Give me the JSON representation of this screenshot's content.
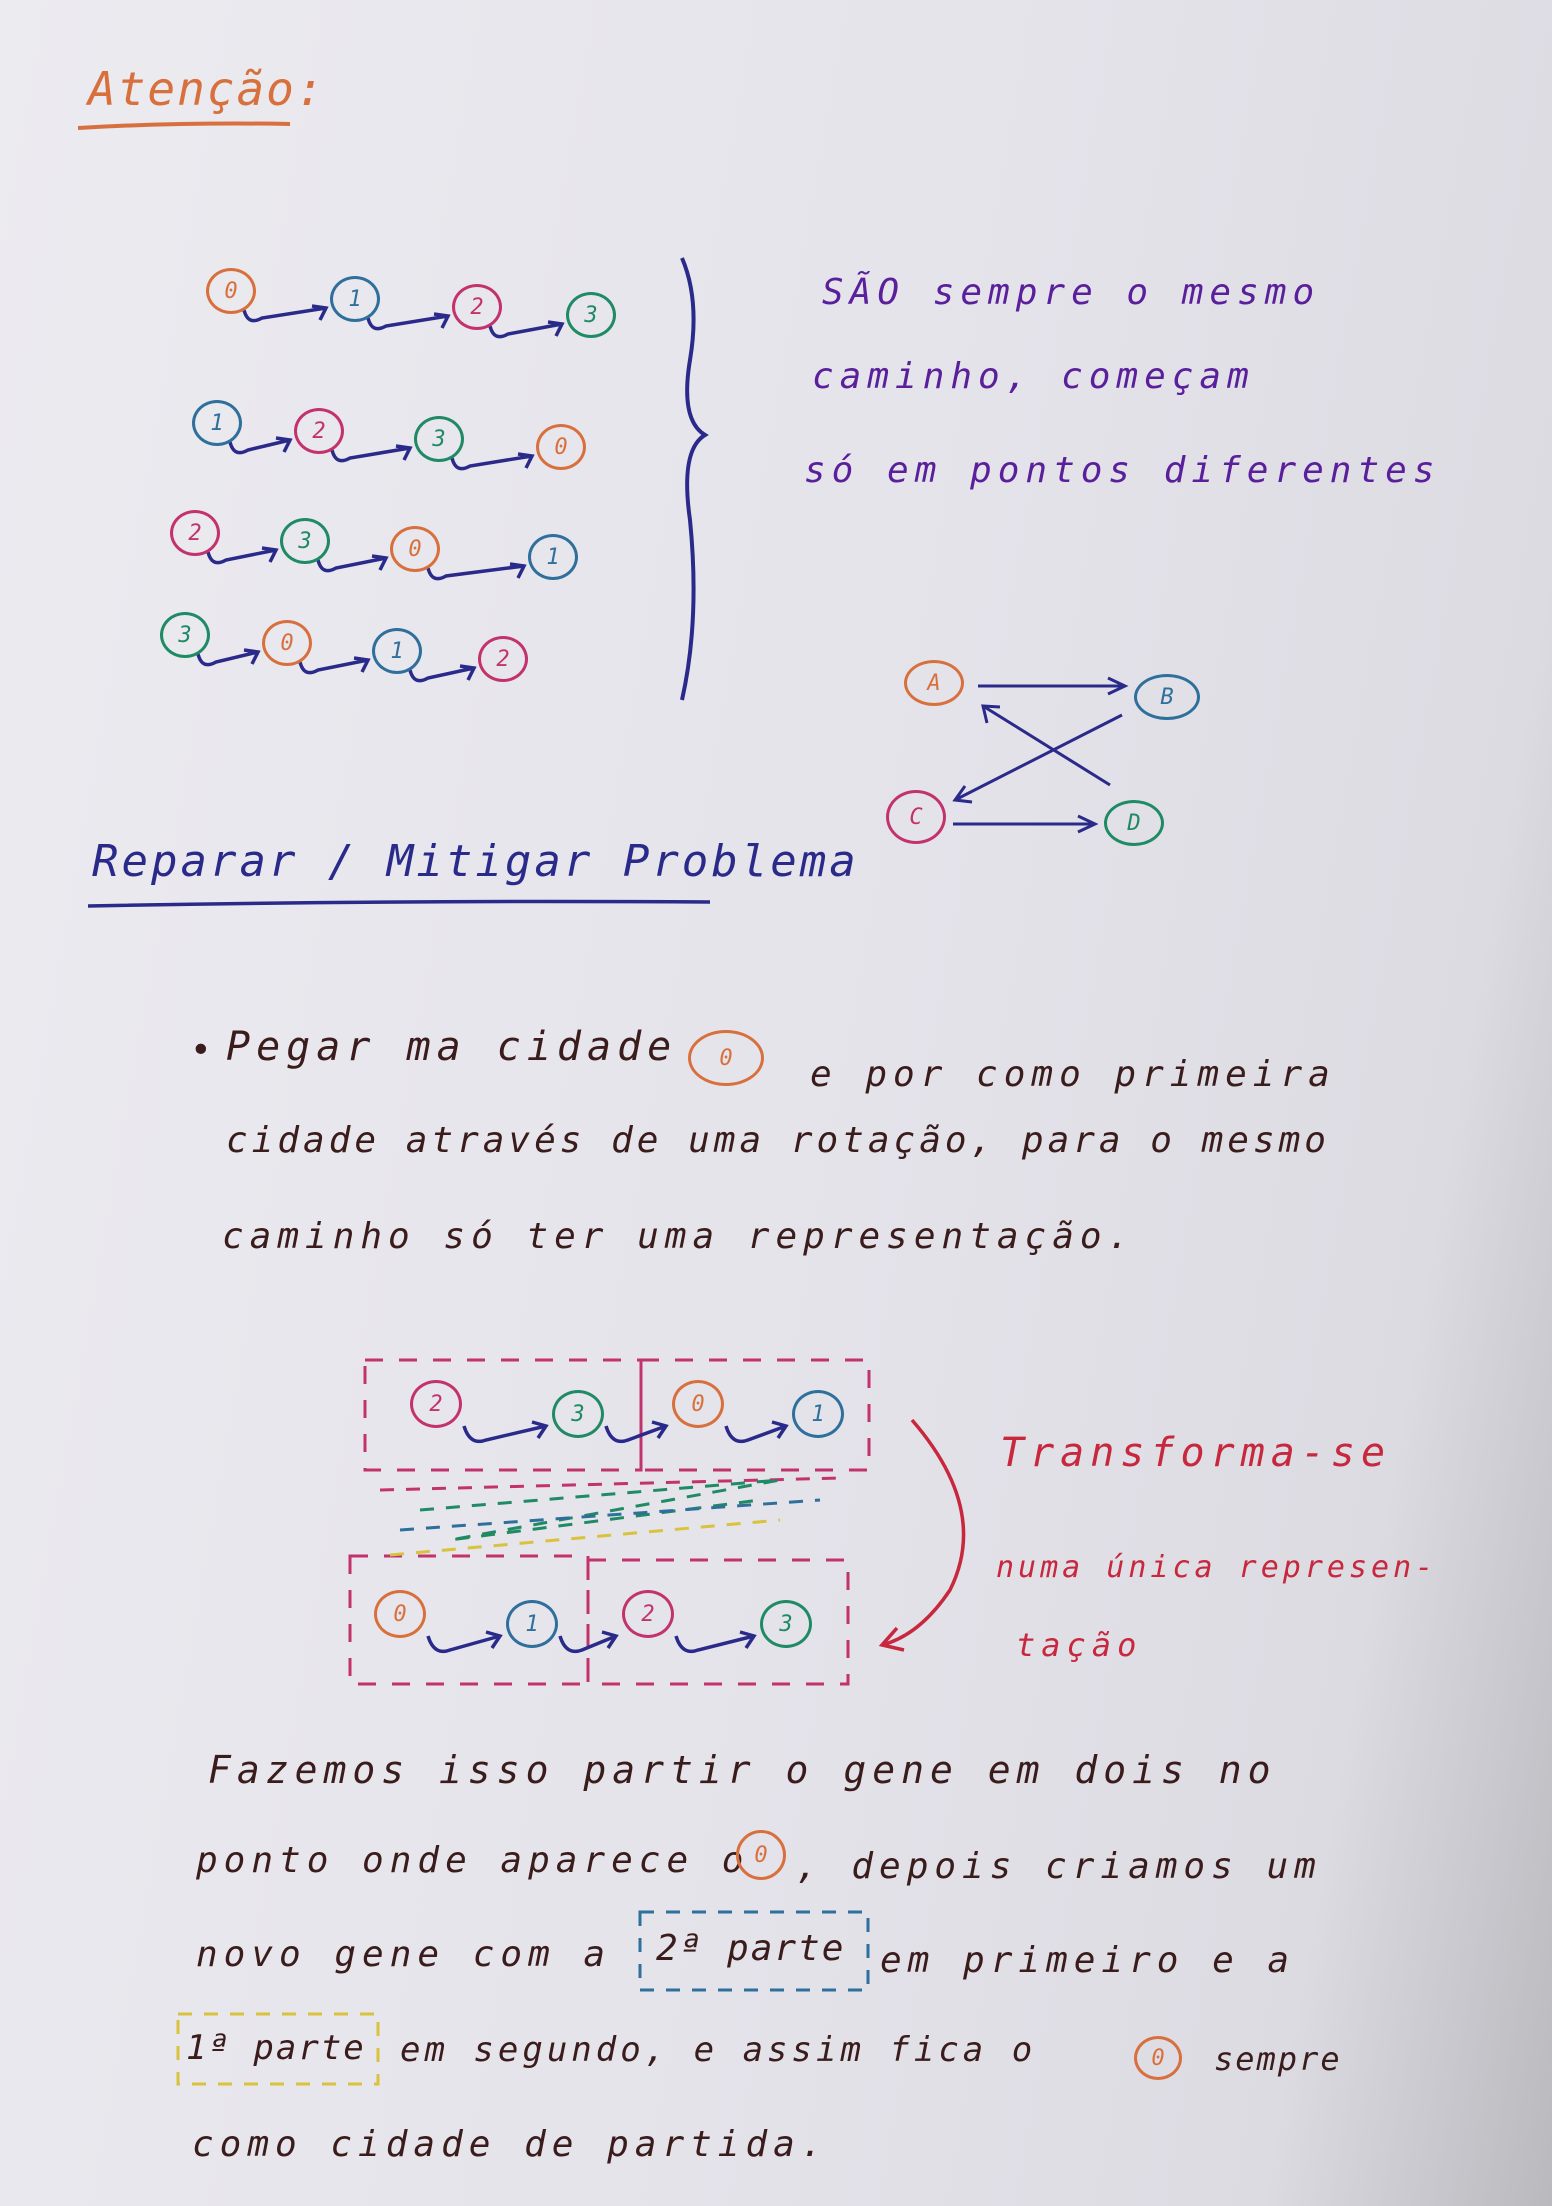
{
  "colors": {
    "orange": "#d8703e",
    "blue": "#2f6f9c",
    "green": "#1f8a63",
    "pink": "#c2336e",
    "ink": "#2a2a8a",
    "red": "#c7283e"
  },
  "heading": "Atenção:",
  "rows": [
    {
      "labels": [
        "0",
        "1",
        "2",
        "3"
      ]
    },
    {
      "labels": [
        "1",
        "2",
        "3",
        "0"
      ]
    },
    {
      "labels": [
        "2",
        "3",
        "0",
        "1"
      ]
    },
    {
      "labels": [
        "3",
        "0",
        "1",
        "2"
      ]
    }
  ],
  "note_lines": [
    "SÃO sempre o mesmo",
    "caminho, começam",
    "só em pontos diferentes"
  ],
  "graph": {
    "a": "A",
    "b": "B",
    "c": "C",
    "d": "D"
  },
  "section_title": "Reparar / Mitigar Problema",
  "bullet": {
    "line1_a": "Pegar ma cidade",
    "line1_circle": "0",
    "line1_b": "e por como primeira",
    "line2": "cidade através de uma rotação, para o mesmo",
    "line3": "caminho só ter uma representação."
  },
  "diagram": {
    "top": [
      "2",
      "3",
      "0",
      "1"
    ],
    "bottom": [
      "0",
      "1",
      "2",
      "3"
    ],
    "label_lines": [
      "Transforma-se",
      "numa única represen-",
      "tação"
    ]
  },
  "para": {
    "l1": "Fazemos isso partir o gene em dois no",
    "l2_a": "ponto onde aparece o",
    "l2_circle": "0",
    "l2_b": ", depois criamos um",
    "l3_a": "novo gene com a",
    "l3_box": "2ª parte",
    "l3_b": "em primeiro e a",
    "l4_box": "1ª parte",
    "l4_a": "em segundo, e assim fica o",
    "l4_circle": "0",
    "l4_b": "sempre",
    "l5": "como cidade de partida."
  }
}
